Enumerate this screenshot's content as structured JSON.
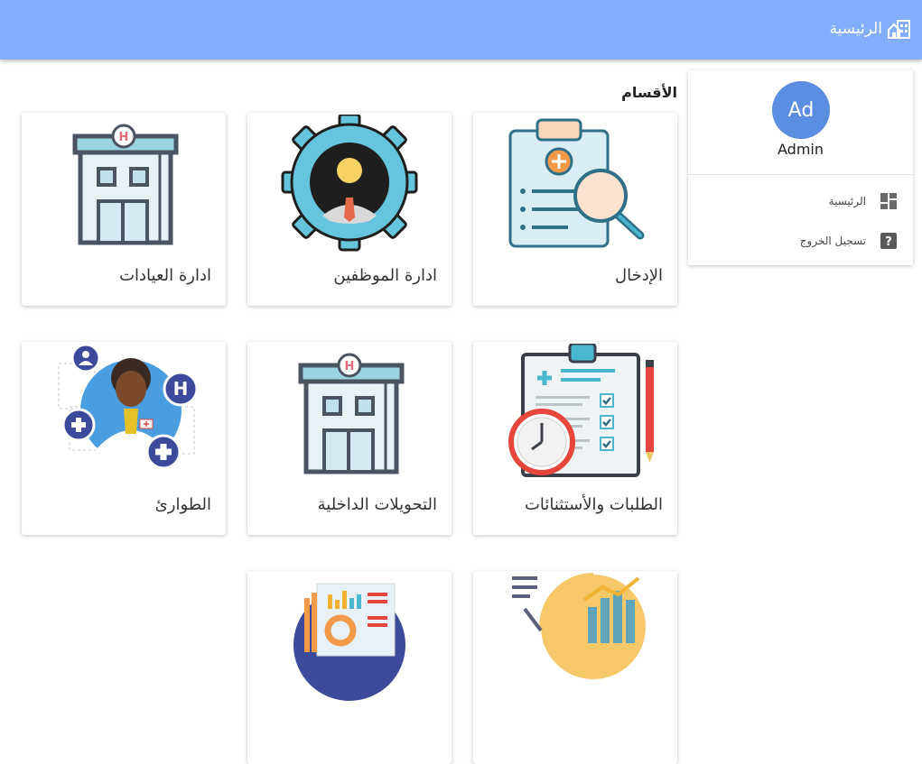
{
  "header": {
    "title": "الرئيسية",
    "icon": "home-building-icon"
  },
  "sidebar": {
    "avatar_initials": "Ad",
    "username": "Admin",
    "items": [
      {
        "label": "الرئيسية",
        "icon": "dashboard-icon"
      },
      {
        "label": "تسجيل الخروج",
        "icon": "help-icon"
      }
    ]
  },
  "main": {
    "section_title": "الأقسام",
    "cards": [
      {
        "label": "الإدخال",
        "icon": "clipboard-search-icon"
      },
      {
        "label": "ادارة الموظفين",
        "icon": "employee-gear-icon"
      },
      {
        "label": "ادارة العيادات",
        "icon": "hospital-building-icon"
      },
      {
        "label": "الطلبات والأستثنائات",
        "icon": "checklist-clock-icon"
      },
      {
        "label": "التحويلات الداخلية",
        "icon": "hospital-building-icon"
      },
      {
        "label": "الطوارئ",
        "icon": "doctor-icon"
      },
      {
        "label": "",
        "icon": "analytics-chart-icon"
      },
      {
        "label": "",
        "icon": "report-dashboard-icon"
      }
    ]
  },
  "colors": {
    "topbar": "#82aefc",
    "avatar": "#5b8ee0",
    "accent_teal": "#4bb7cf",
    "dark": "#4b5462"
  }
}
